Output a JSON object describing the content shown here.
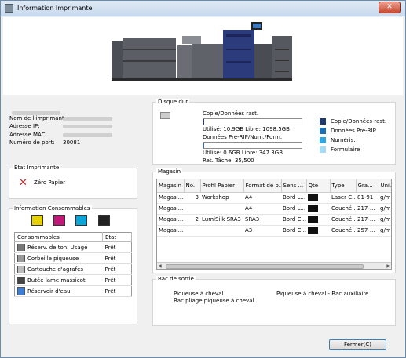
{
  "window": {
    "title": "Information Imprimante",
    "close_label": "✕"
  },
  "info": {
    "labels": [
      "Nom de l'imprimante:",
      "Adresse IP:",
      "Adresse MAC:",
      "Numéro de port:"
    ],
    "port": "30081"
  },
  "disk": {
    "legend": "Disque dur",
    "copy_label": "Copie/Données rast.",
    "copy_usage": "Utilisé: 10.9GB Libre: 1098.5GB",
    "pre_label": "Données Pré-RIP/Num./Form.",
    "pre_usage": "Utilisé: 0.6GB Libre: 347.3GB",
    "ret": "Ret. Tâche: 35/500",
    "copy_fill": 0.01,
    "pre_fill": 0.002,
    "legend_items": [
      {
        "label": "Copie/Données rast.",
        "color": "#1f3a6e"
      },
      {
        "label": "Données Pré-RIP",
        "color": "#1b6fb4"
      },
      {
        "label": "Numéris.",
        "color": "#2fa7e0"
      },
      {
        "label": "Formulaire",
        "color": "#a6dcf5"
      }
    ]
  },
  "status": {
    "legend": "État Imprimante",
    "message": "Zéro Papier"
  },
  "consumables": {
    "legend": "Information Consommables",
    "col_name": "Consommables",
    "col_state": "Etat",
    "rows": [
      {
        "name": "Réserv. de ton. Usagé",
        "state": "Prêt",
        "icon": "toner-waste-icon"
      },
      {
        "name": "Corbeille piqueuse",
        "state": "Prêt",
        "icon": "staple-tray-icon"
      },
      {
        "name": "Cartouche d'agrafes",
        "state": "Prêt",
        "icon": "staple-cartridge-icon"
      },
      {
        "name": "Butée lame massicot",
        "state": "Prêt",
        "icon": "trimmer-stopper-icon"
      },
      {
        "name": "Réservoir d'eau",
        "state": "Prêt",
        "icon": "water-tank-icon"
      }
    ]
  },
  "magasin": {
    "legend": "Magasin",
    "columns": [
      "Magasin",
      "No.",
      "Profil Papier",
      "Format de p...",
      "Sens ...",
      "Qte",
      "Type",
      "Gra...",
      "Uni..."
    ],
    "rows": [
      [
        "Magasi...",
        "3",
        "Workshop",
        "A4",
        "Bord L...",
        "",
        "Laser C...",
        "81-91",
        "g/m²"
      ],
      [
        "Magasi...",
        "",
        "",
        "A4",
        "Bord L...",
        "",
        "Couché...",
        "217-...",
        "g/m²"
      ],
      [
        "Magasi...",
        "2",
        "LumiSilk SRA3",
        "SRA3",
        "Bord C...",
        "",
        "Couché...",
        "217-...",
        "g/m²"
      ],
      [
        "Magasi...",
        "",
        "",
        "A3",
        "Bord C...",
        "",
        "Couché...",
        "257-...",
        "g/m²"
      ]
    ]
  },
  "output": {
    "legend": "Bac de sortie",
    "items": [
      "Piqueuse à cheval",
      "Piqueuse à cheval - Bac auxiliaire",
      "Bac pliage piqueuse à cheval"
    ]
  },
  "footer": {
    "close_label": "Fermer(C)"
  }
}
